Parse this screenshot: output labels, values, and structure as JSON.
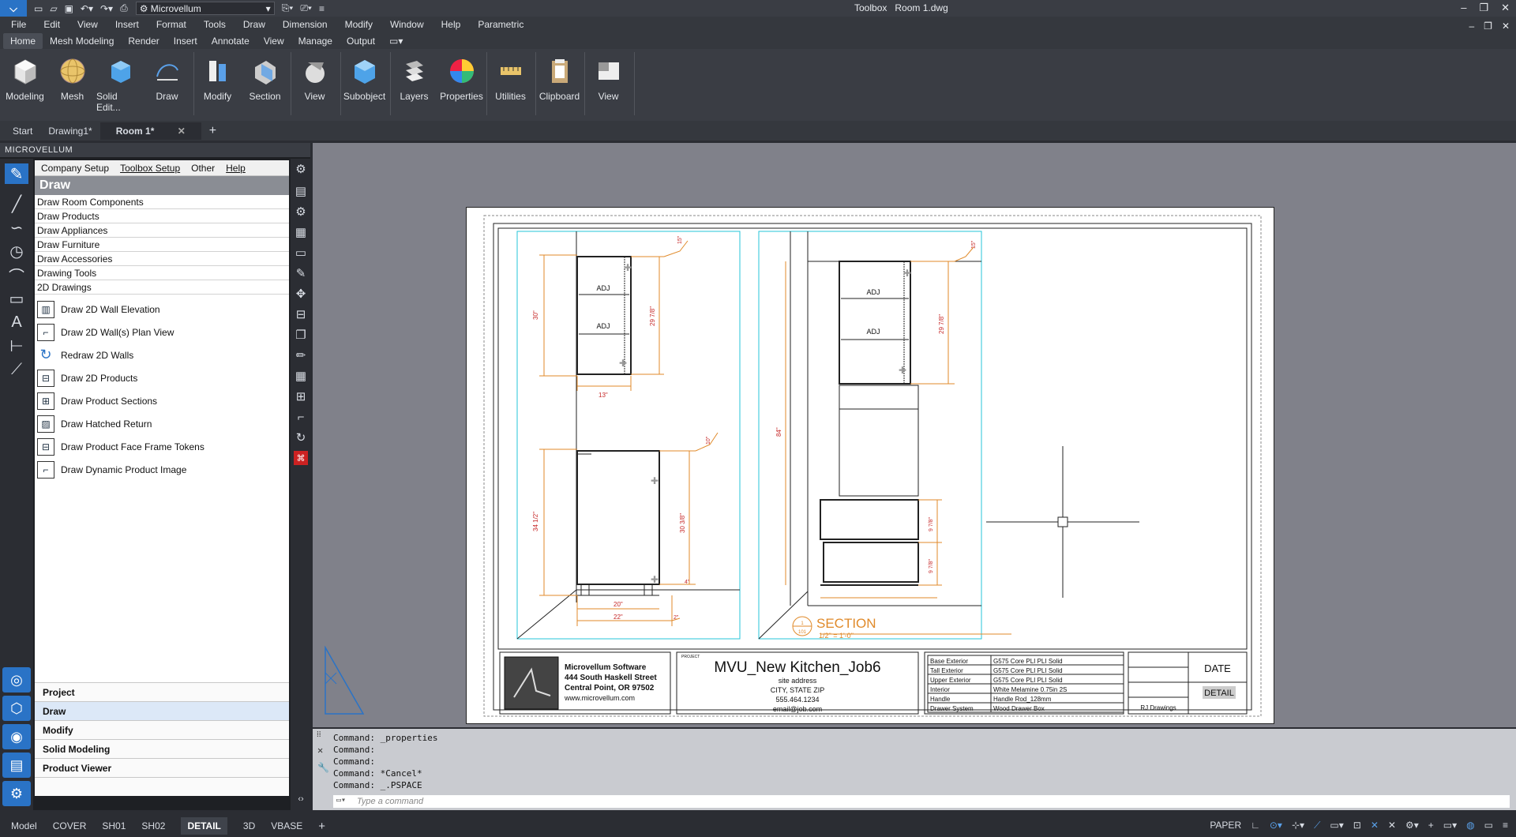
{
  "qat": {
    "workspace": "Microvellum"
  },
  "title": {
    "app": "Toolbox",
    "file": "Room 1.dwg"
  },
  "menubar": [
    "File",
    "Edit",
    "View",
    "Insert",
    "Format",
    "Tools",
    "Draw",
    "Dimension",
    "Modify",
    "Window",
    "Help",
    "Parametric"
  ],
  "ribbon_tabs": [
    "Home",
    "Mesh Modeling",
    "Render",
    "Insert",
    "Annotate",
    "View",
    "Manage",
    "Output"
  ],
  "ribbon_buttons": [
    "Modeling",
    "Mesh",
    "Solid Edit...",
    "Draw",
    "Modify",
    "Section",
    "View",
    "Subobject",
    "Layers",
    "Properties",
    "Utilities",
    "Clipboard",
    "View"
  ],
  "doc_tabs": [
    "Start",
    "Drawing1*",
    "Room 1*"
  ],
  "panel": {
    "title": "MICROVELLUM",
    "submenu": [
      "Company Setup",
      "Toolbox Setup",
      "Other",
      "Help"
    ],
    "header": "Draw",
    "categories": [
      "Draw Room Components",
      "Draw Products",
      "Draw Appliances",
      "Draw Furniture",
      "Draw Accessories",
      "Drawing Tools",
      "2D Drawings"
    ],
    "items": [
      "Draw 2D Wall Elevation",
      "Draw 2D Wall(s) Plan View",
      "Redraw 2D Walls",
      "Draw 2D Products",
      "Draw Product Sections",
      "Draw Hatched Return",
      "Draw Product Face Frame Tokens",
      "Draw Dynamic Product Image"
    ],
    "bottom_nav": [
      "Project",
      "Draw",
      "Modify",
      "Solid Modeling",
      "Product Viewer"
    ]
  },
  "drawing": {
    "dims": {
      "d30": "30\"",
      "d29": "29 7/8\"",
      "d13": "13\"",
      "d34": "34 1/2\"",
      "d30b": "30 3/8\"",
      "d20": "20\"",
      "d22": "22\"",
      "d2": "2\"",
      "d84": "84\"",
      "d29b": "29 7/8\"",
      "d97a": "9 7/8\"",
      "d97b": "9 7/8\"",
      "small1": "15\"",
      "small2": "10\"",
      "small3": "4\"",
      "small4": "15\""
    },
    "adj": "ADJ",
    "section_title": "SECTION",
    "section_scale": "1/2\" = 1'-0\"",
    "section_num": "1",
    "section_sheet": "101",
    "company": [
      "Microvellum Software",
      "444 South Haskell Street",
      "Central Point, OR 97502",
      "www.microvellum.com"
    ],
    "project_label": "PROJECT",
    "project_name": "MVU_New Kitchen_Job6",
    "site": [
      "site address",
      "CITY, STATE ZIP",
      "555.464.1234",
      "email@job.com"
    ],
    "materials": [
      [
        "Base Exterior",
        "G575 Core PLI PLI Solid"
      ],
      [
        "Tall Exterior",
        "G575 Core PLI PLI Solid"
      ],
      [
        "Upper Exterior",
        "G575 Core PLI PLI Solid"
      ],
      [
        "Interior",
        "White Melamine 0.75in 2S"
      ],
      [
        "Handle",
        "Handle Rod_128mm"
      ],
      [
        "Drawer System",
        "Wood Drawer Box"
      ]
    ],
    "date_label": "DATE",
    "detail_label": "DETAIL",
    "drawn_by": "RJ Drawings"
  },
  "command_history": [
    "Command: _properties",
    "Command:",
    "Command:",
    "Command: *Cancel*",
    "Command: _.PSPACE"
  ],
  "command_placeholder": "Type a command",
  "layout_tabs": [
    "Model",
    "COVER",
    "SH01",
    "SH02",
    "DETAIL",
    "3D",
    "VBASE"
  ],
  "status": {
    "space": "PAPER"
  }
}
